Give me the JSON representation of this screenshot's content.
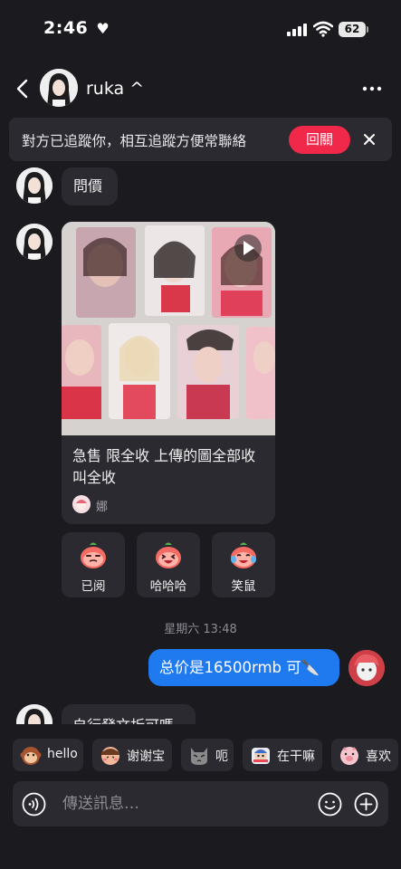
{
  "status_bar": {
    "time": "2:46",
    "heart_glyph": "♥",
    "battery": "62"
  },
  "header": {
    "username": "ruka ^"
  },
  "banner": {
    "text": "對方已追蹤你，相互追蹤方便常聯絡",
    "follow_label": "回關"
  },
  "messages": {
    "first_text": "問價",
    "card": {
      "title": "急售 限全收 上傳的圖全部收叫全收",
      "author": "娜"
    },
    "reactions": [
      {
        "label": "已阅",
        "icon": "peach-face-icon"
      },
      {
        "label": "哈哈哈",
        "icon": "laughing-peach-icon"
      },
      {
        "label": "笑鼠",
        "icon": "crying-laughing-peach-icon"
      }
    ],
    "day_divider": "星期六 13:48",
    "outgoing_text": "总价是16500rmb 可🔪",
    "partial_text": "自行發文折可嗎"
  },
  "quick_replies": [
    {
      "label": "hello",
      "icon": "monkey-icon"
    },
    {
      "label": "谢谢宝",
      "icon": "bowing-character-icon"
    },
    {
      "label": "呃",
      "icon": "cat-icon"
    },
    {
      "label": "在干嘛",
      "icon": "peeking-character-icon"
    },
    {
      "label": "喜欢",
      "icon": "pig-icon"
    }
  ],
  "input": {
    "placeholder": "傳送訊息…"
  },
  "colors": {
    "accent_red": "#f0284a",
    "accent_blue": "#1f7af0",
    "background": "#1a1a1f",
    "surface": "#2a2a30"
  }
}
